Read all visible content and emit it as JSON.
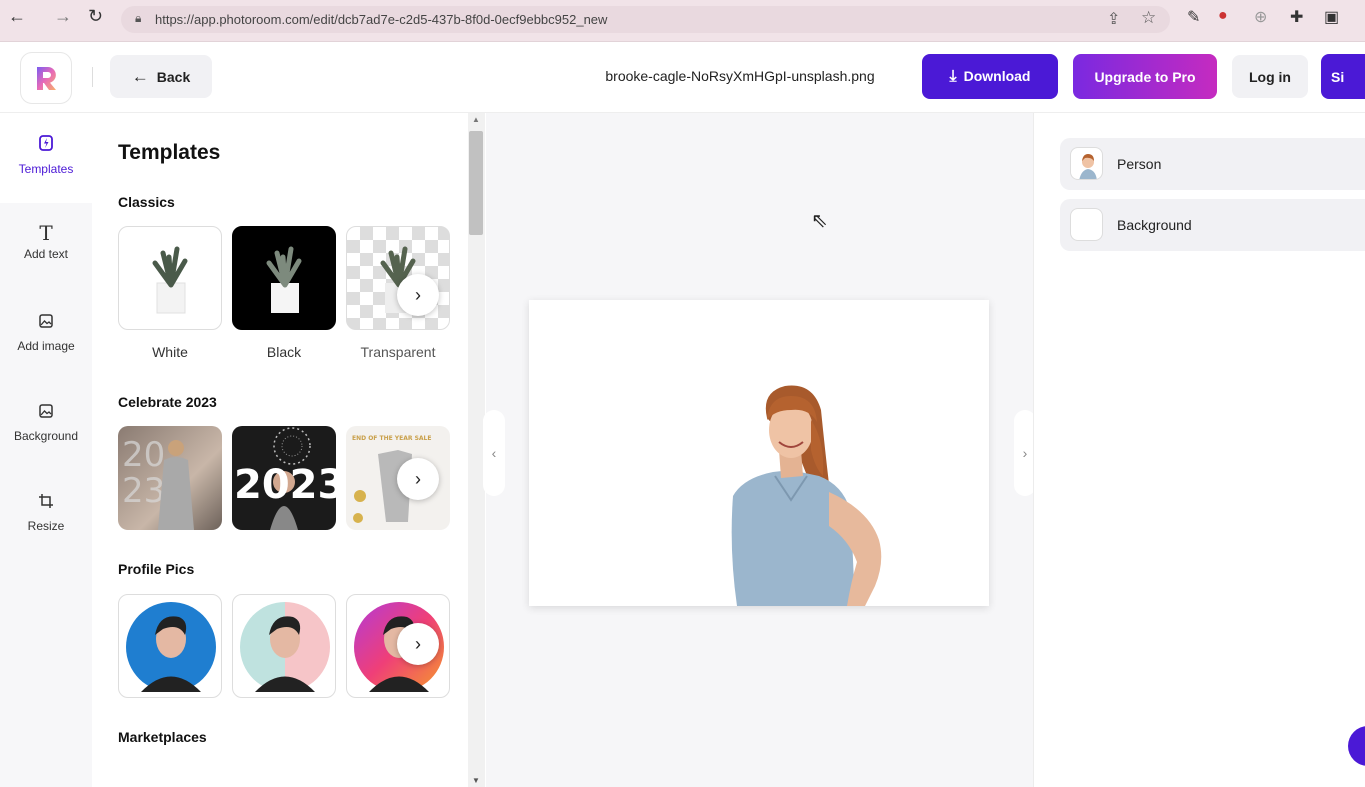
{
  "browser": {
    "back_icon": "arrow-left-icon",
    "forward_icon": "arrow-right-icon",
    "reload_icon": "reload-icon",
    "url": "https://app.photoroom.com/edit/dcb7ad7e-c2d5-437b-8f0d-0ecf9ebbc952_new"
  },
  "header": {
    "back_label": "Back",
    "filename": "brooke-cagle-NoRsyXmHGpI-unsplash.png",
    "download_label": "Download",
    "upgrade_label": "Upgrade to Pro",
    "login_label": "Log in",
    "signup_label": "Si",
    "colors": {
      "primary": "#4b19d6",
      "pro_gradient_start": "#7a29e0",
      "pro_gradient_end": "#c52bc0"
    }
  },
  "rail": {
    "items": [
      {
        "label": "Templates",
        "icon": "templates-icon",
        "active": true
      },
      {
        "label": "Add text",
        "icon": "text-icon"
      },
      {
        "label": "Add image",
        "icon": "image-icon"
      },
      {
        "label": "Background",
        "icon": "background-icon"
      },
      {
        "label": "Resize",
        "icon": "crop-icon"
      }
    ]
  },
  "templates": {
    "title": "Templates",
    "sections": [
      {
        "name": "Classics",
        "captions": [
          "White",
          "Black",
          "Transparent"
        ]
      },
      {
        "name": "Celebrate 2023",
        "captions": []
      },
      {
        "name": "Profile Pics",
        "captions": []
      },
      {
        "name": "Marketplaces",
        "captions": []
      }
    ],
    "celebrate_text": "2023",
    "end_of_year_text": "END OF THE YEAR SALE"
  },
  "layers": {
    "items": [
      {
        "label": "Person",
        "icon": "person-thumbnail"
      },
      {
        "label": "Background",
        "icon": "blank-thumbnail"
      }
    ]
  }
}
